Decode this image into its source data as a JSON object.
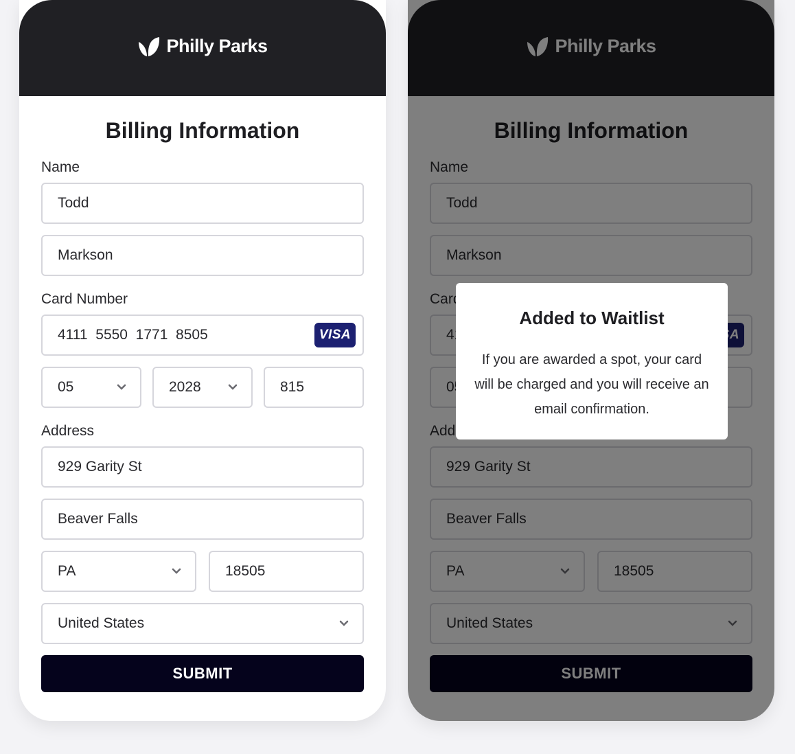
{
  "brand": {
    "name": "Philly Parks",
    "icon": "leaf-icon"
  },
  "form": {
    "title": "Billing Information",
    "name_label": "Name",
    "first_name": "Todd",
    "last_name": "Markson",
    "card_label": "Card Number",
    "card_number": "4111  5550  1771  8505",
    "card_brand": "VISA",
    "exp_month": "05",
    "exp_year": "2028",
    "cvv": "815",
    "address_label": "Address",
    "street": "929 Garity St",
    "city": "Beaver Falls",
    "state": "PA",
    "zip": "18505",
    "country": "United States",
    "submit_label": "SUBMIT"
  },
  "modal": {
    "title": "Added to Waitlist",
    "body": "If you are awarded a spot, your card will be charged and you will receive an email confirmation."
  },
  "colors": {
    "header": "#202024",
    "submit": "#05031c",
    "visa": "#1c2071",
    "overlay": "rgba(0,0,0,0.5)"
  }
}
